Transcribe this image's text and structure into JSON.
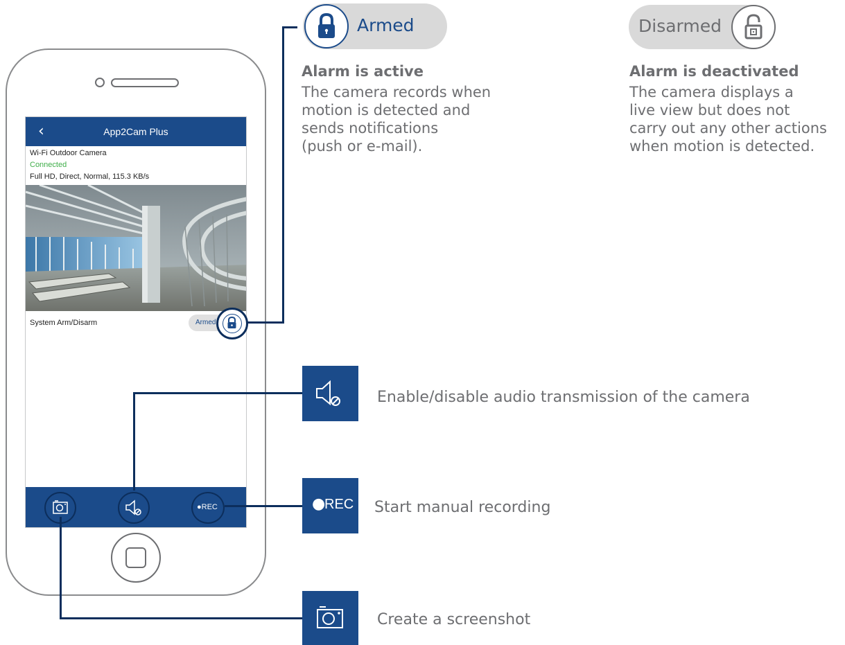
{
  "app": {
    "title": "App2Cam Plus",
    "back_icon": "chevron-left-icon",
    "camera_name": "Wi-Fi Outdoor Camera",
    "status": "Connected",
    "stream_info": "Full HD, Direct, Normal, 115.3 KB/s",
    "arm_row_label": "System Arm/Disarm",
    "arm_toggle_label": "Armed",
    "toolbar": {
      "screenshot_icon": "camera-icon",
      "audio_icon": "speaker-mute-icon",
      "rec_label": "●REC"
    }
  },
  "legend": {
    "armed": {
      "pill_label": "Armed",
      "title": "Alarm is active",
      "text": "The camera records when\nmotion is detected and\nsends notifications\n(push or e-mail)."
    },
    "disarmed": {
      "pill_label": "Disarmed",
      "title": "Alarm is deactivated",
      "text": "The camera displays a\nlive view but does not\ncarry out any other actions\nwhen motion is detected."
    },
    "audio": {
      "text": "Enable/disable audio transmission of the camera"
    },
    "rec": {
      "label": "REC",
      "text": "Start manual recording"
    },
    "screenshot": {
      "text": "Create a screenshot"
    }
  },
  "colors": {
    "brand_blue": "#1b4b8a",
    "dark_navy": "#0c2e5c",
    "connected_green": "#3fae49",
    "text_gray": "#6d6e71"
  }
}
